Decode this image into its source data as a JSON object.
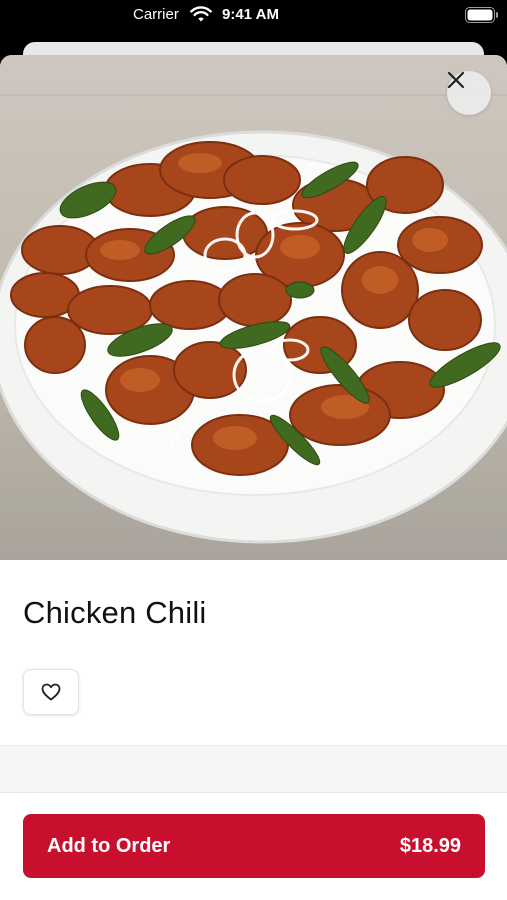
{
  "status_bar": {
    "carrier": "Carrier",
    "time": "9:41 AM",
    "icons": [
      "wifi-icon",
      "battery-icon"
    ]
  },
  "item": {
    "name": "Chicken Chili",
    "image_alt": "chicken-chili-photo"
  },
  "actions": {
    "close_icon": "close-icon",
    "favorite_icon": "heart-icon",
    "add_label": "Add to Order",
    "price": "$18.99"
  },
  "colors": {
    "accent": "#c8102e",
    "background": "#ffffff",
    "status_bar": "#000000"
  }
}
